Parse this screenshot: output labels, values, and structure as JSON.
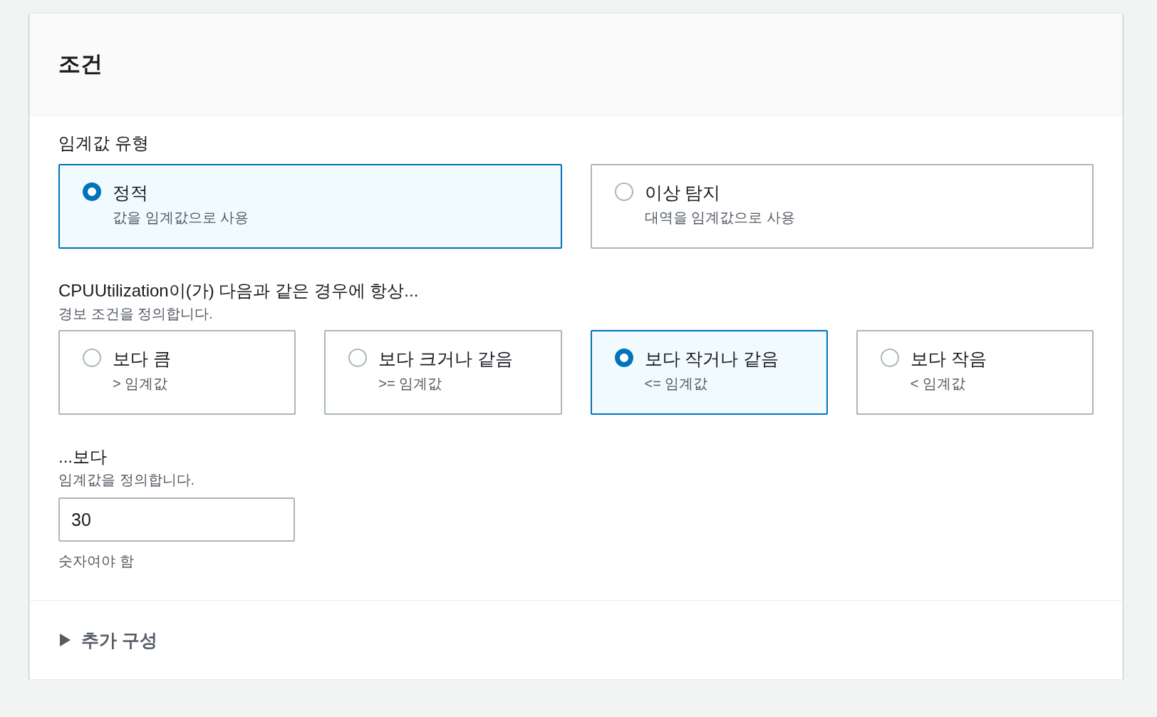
{
  "title": "조건",
  "threshold_type": {
    "label": "임계값 유형",
    "options": [
      {
        "label": "정적",
        "description": "값을 임계값으로 사용",
        "selected": true
      },
      {
        "label": "이상 탐지",
        "description": "대역을 임계값으로 사용",
        "selected": false
      }
    ]
  },
  "condition": {
    "label": "CPUUtilization이(가) 다음과 같은 경우에 항상...",
    "description": "경보 조건을 정의합니다.",
    "options": [
      {
        "label": "보다 큼",
        "description": "> 임계값",
        "selected": false
      },
      {
        "label": "보다 크거나 같음",
        "description": ">= 임계값",
        "selected": false
      },
      {
        "label": "보다 작거나 같음",
        "description": "<= 임계값",
        "selected": true
      },
      {
        "label": "보다 작음",
        "description": "< 임계값",
        "selected": false
      }
    ]
  },
  "threshold": {
    "label": "...보다",
    "description": "임계값을 정의합니다.",
    "value": "30",
    "constraint": "숫자여야 함"
  },
  "additional": {
    "label": "추가 구성",
    "expanded": false
  }
}
